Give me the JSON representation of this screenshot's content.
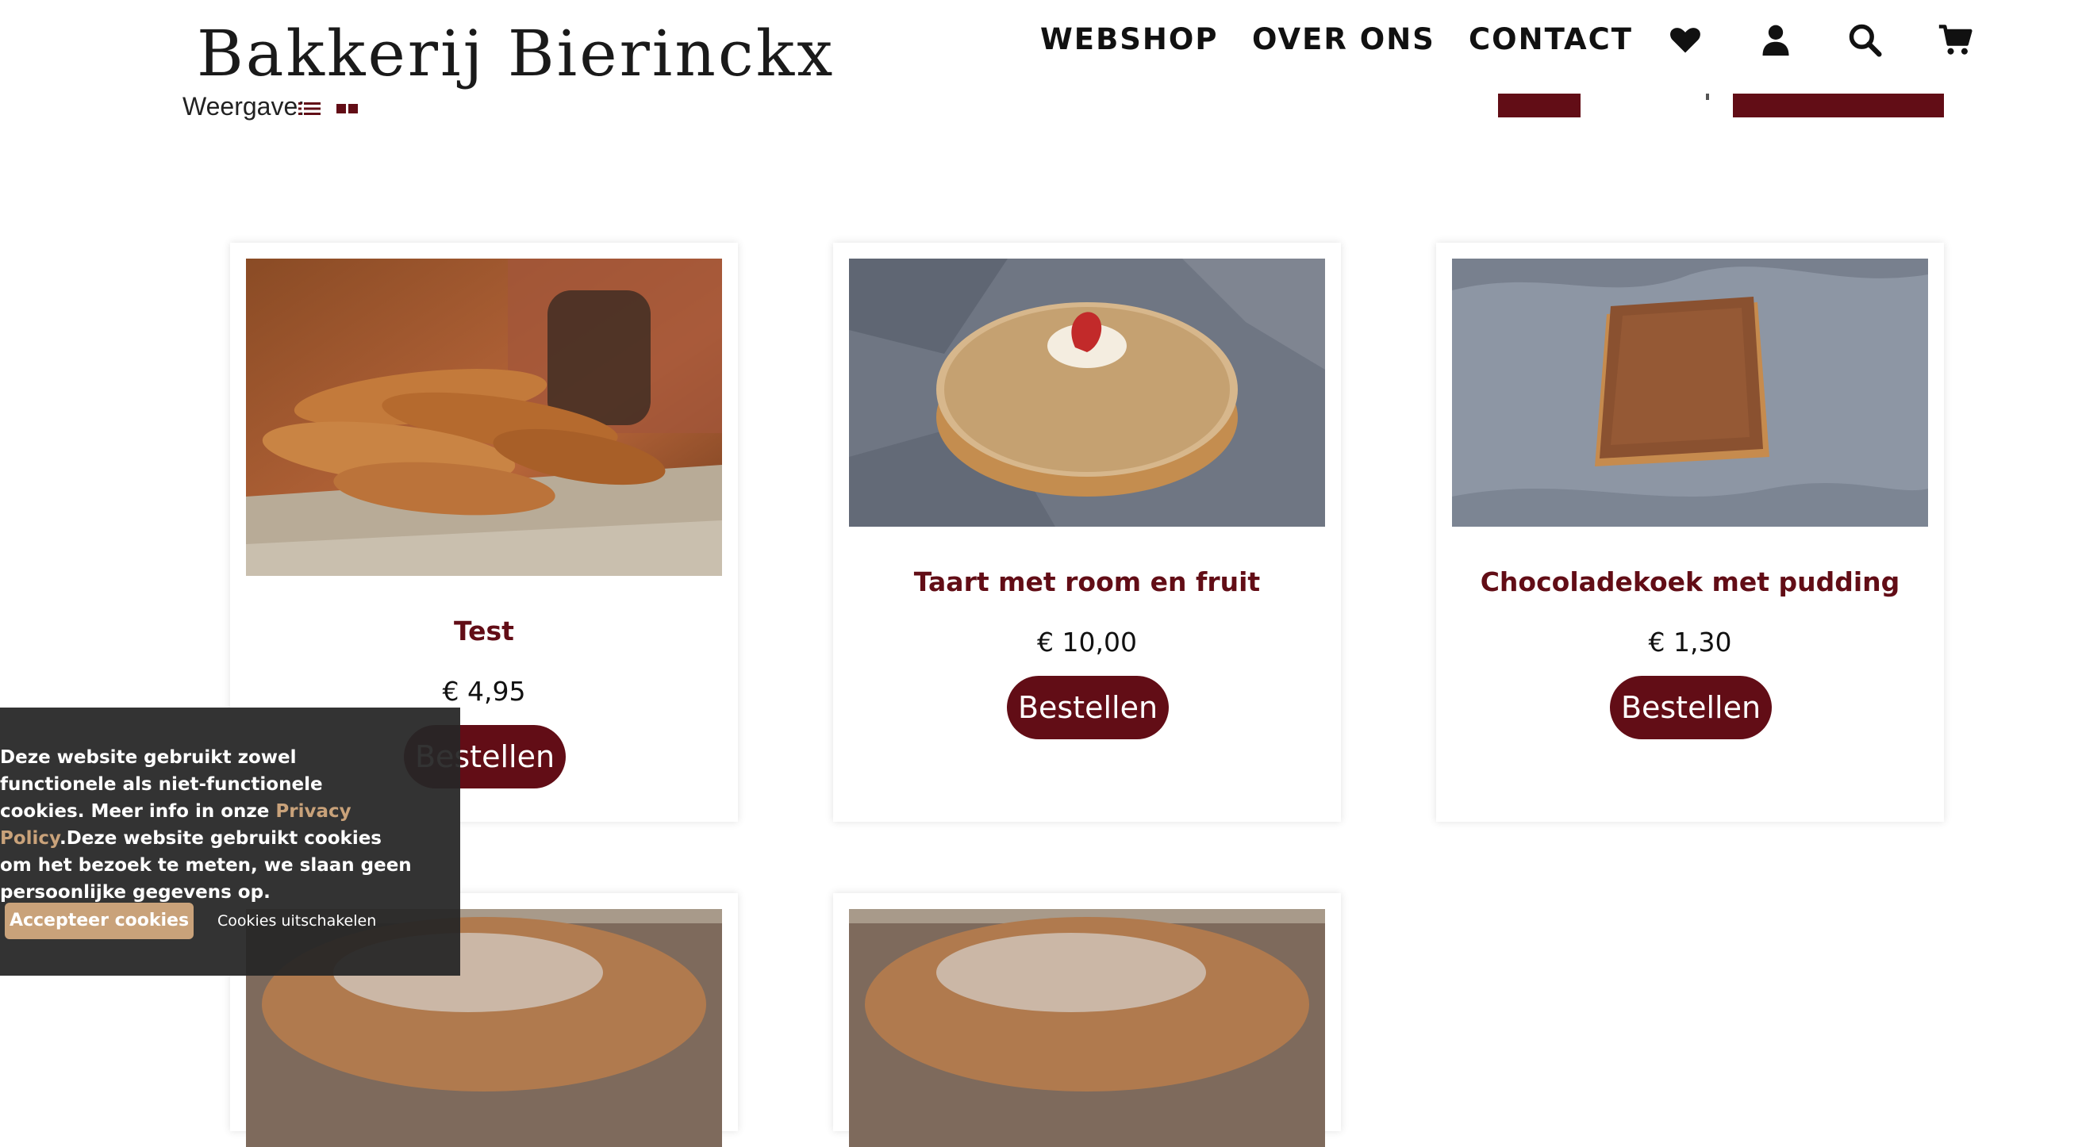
{
  "header": {
    "logo": "Bakkerij Bierinckx",
    "nav": [
      {
        "label": "WEBSHOP"
      },
      {
        "label": "OVER ONS"
      },
      {
        "label": "CONTACT"
      }
    ],
    "icons": [
      "heart-icon",
      "user-icon",
      "search-icon",
      "cart-icon"
    ]
  },
  "toolbar": {
    "view_label": "Weergave:"
  },
  "products": [
    {
      "title": "Test",
      "price": "€ 4,95",
      "button": "Bestellen",
      "image": "baguettes"
    },
    {
      "title": "Taart met room en fruit",
      "price": "€ 10,00",
      "button": "Bestellen",
      "image": "cake"
    },
    {
      "title": "Chocoladekoek met pudding",
      "price": "€ 1,30",
      "button": "Bestellen",
      "image": "chocolate-pastry"
    },
    {
      "title": "",
      "price": "",
      "button": "",
      "image": "bread"
    },
    {
      "title": "",
      "price": "",
      "button": "",
      "image": "bread"
    }
  ],
  "cookie_banner": {
    "text_before": "Deze website gebruikt zowel functionele als niet-functionele cookies. Meer info in onze ",
    "link": "Privacy Policy",
    "text_after": ".Deze website gebruikt cookies om het bezoek te meten, we slaan geen persoonlijke gegevens op.",
    "accept": "Accepteer cookies",
    "disable": "Cookies uitschakelen"
  },
  "colors": {
    "brand": "#620d16",
    "cookie_accent": "#c9a27a",
    "cookie_bg": "#262626"
  }
}
